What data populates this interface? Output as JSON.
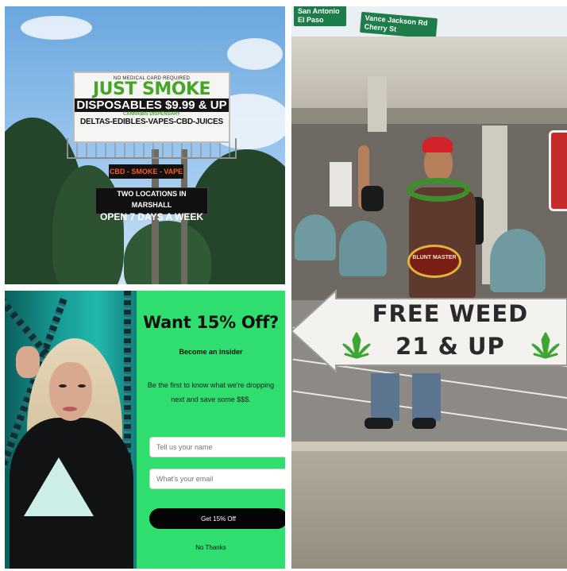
{
  "billboard": {
    "top_note": "NO MEDICAL CARD REQUIRED",
    "headline": "JUST SMOKE",
    "offer": "DISPOSABLES $9.99 & UP",
    "subhead": "CANNABIS DISPENSARY",
    "products": "DELTAS-EDIBLES-VAPES-CBD-JUICES",
    "sign_lower": "CBD - SMOKE - VAPE",
    "locations_line1": "TWO LOCATIONS IN MARSHALL",
    "locations_line2": "OPEN 7 DAYS A WEEK"
  },
  "popup": {
    "title": "Want 15% Off?",
    "subtitle": "Become an insider",
    "body": "Be the first to know what we're dropping next and save some $$$.",
    "name_placeholder": "Tell us your name",
    "email_placeholder": "What's your email",
    "submit_label": "Get 15% Off",
    "decline_label": "No Thanks",
    "accent_color": "#2fde6e"
  },
  "street": {
    "highway_sign_left": "San Antonio El Paso",
    "highway_sign_right": "Vance Jackson Rd Cherry St",
    "shirt_badge": "BLUNT MASTER",
    "arrow_line1": "FREE WEED",
    "arrow_line2": "21 & UP"
  }
}
